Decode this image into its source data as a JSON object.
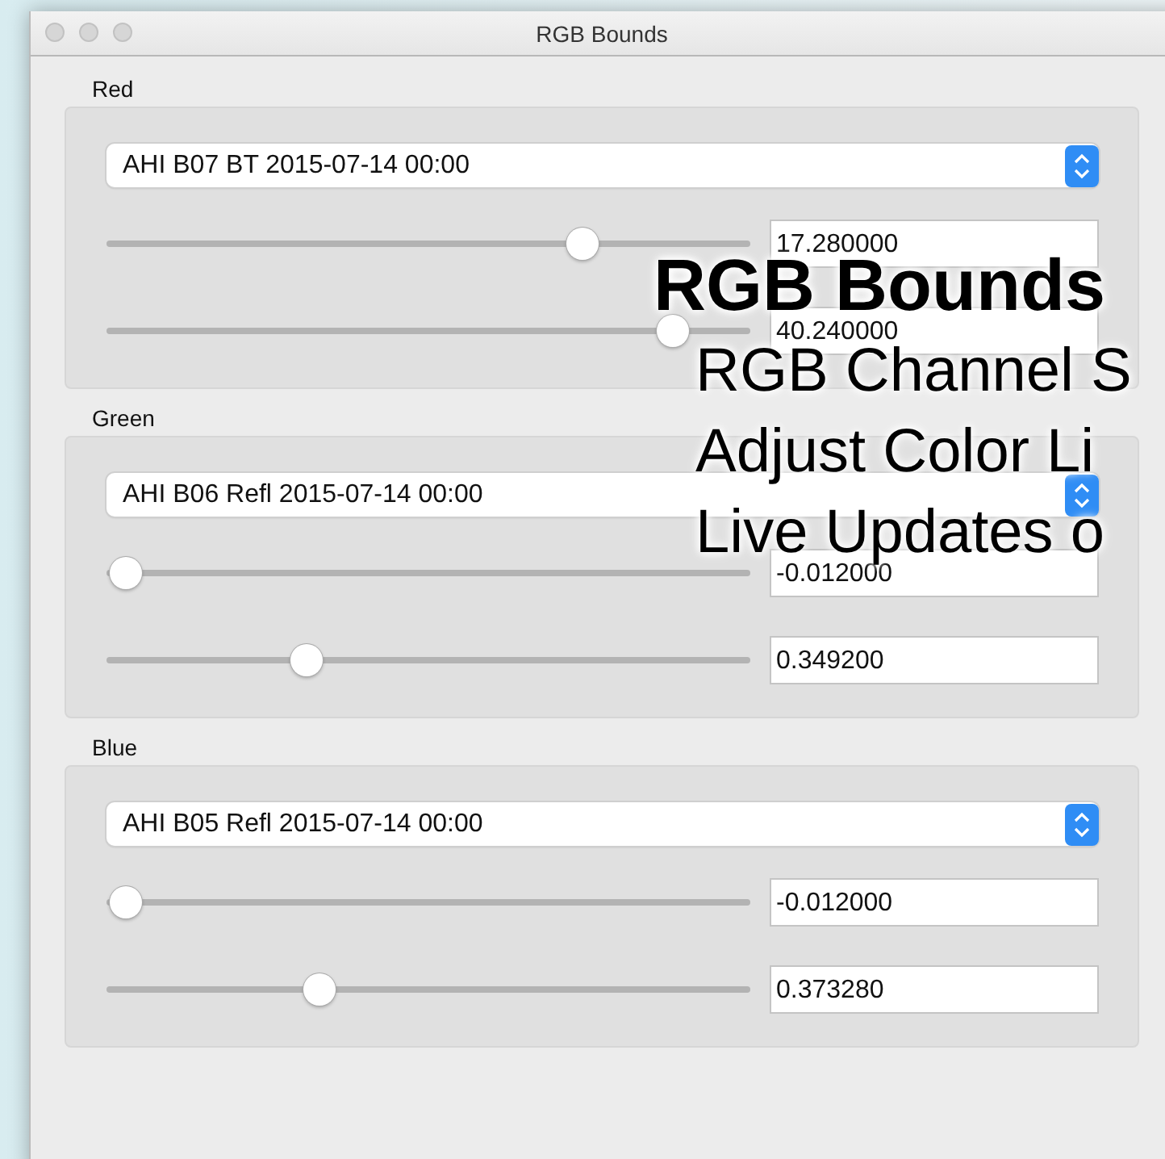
{
  "window": {
    "title": "RGB Bounds"
  },
  "channels": [
    {
      "label": "Red",
      "source": "AHI B07 BT 2015-07-14 00:00",
      "sliders": [
        {
          "level": 0.74,
          "value": "17.280000"
        },
        {
          "level": 0.88,
          "value": "40.240000"
        }
      ]
    },
    {
      "label": "Green",
      "source": "AHI B06 Refl 2015-07-14 00:00",
      "sliders": [
        {
          "level": 0.03,
          "value": "-0.012000"
        },
        {
          "level": 0.31,
          "value": "0.349200"
        }
      ]
    },
    {
      "label": "Blue",
      "source": "AHI B05 Refl 2015-07-14 00:00",
      "sliders": [
        {
          "level": 0.03,
          "value": "-0.012000"
        },
        {
          "level": 0.33,
          "value": "0.373280"
        }
      ]
    }
  ],
  "overlay": {
    "title": "RGB Bounds",
    "lines": [
      "RGB Channel S",
      "Adjust Color Li",
      "Live Updates o"
    ]
  }
}
